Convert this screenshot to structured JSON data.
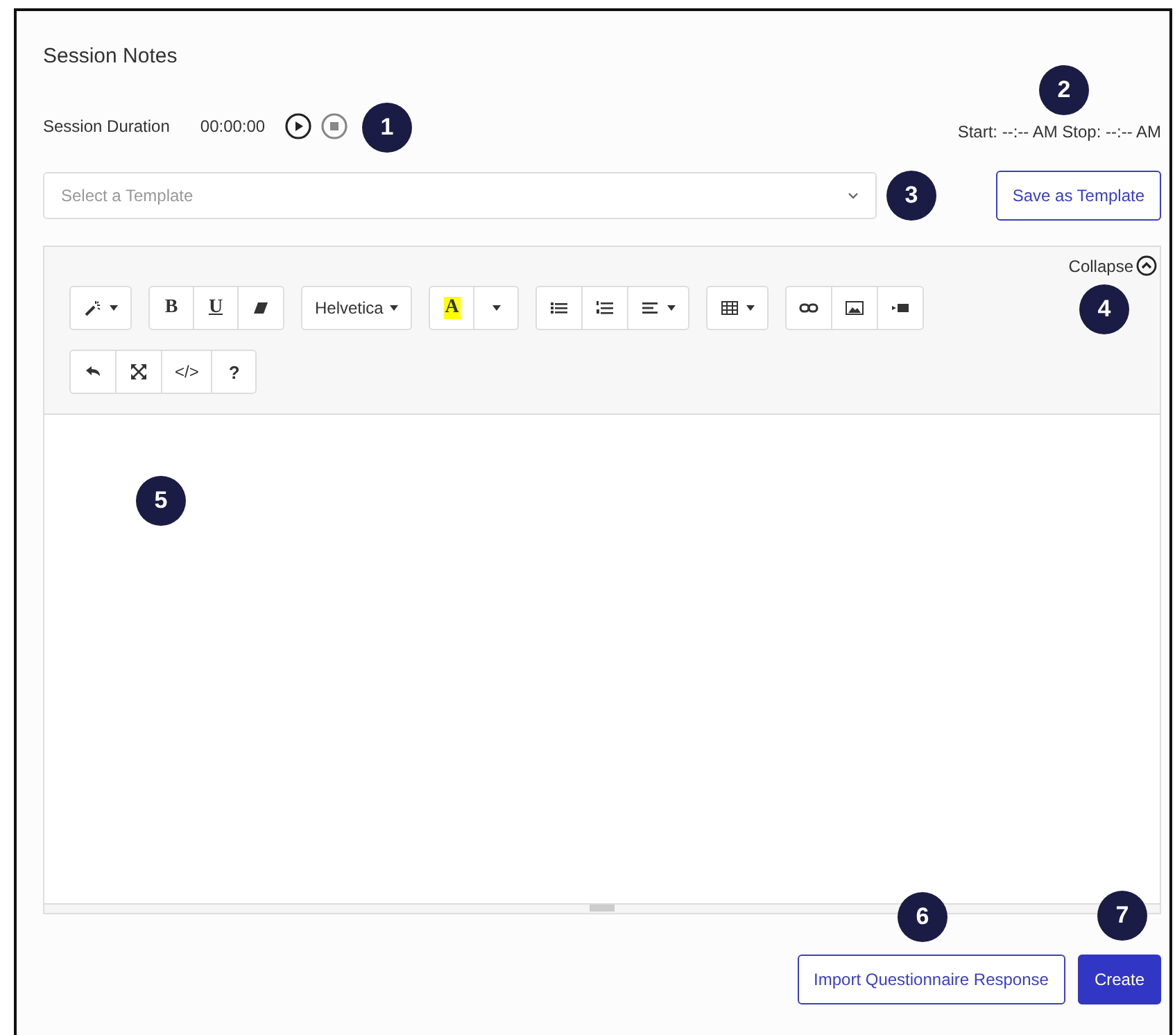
{
  "title": "Session Notes",
  "duration": {
    "label": "Session Duration",
    "time": "00:00:00",
    "start_stop": "Start: --:-- AM Stop: --:-- AM"
  },
  "template_select": {
    "placeholder": "Select a Template"
  },
  "save_template_button": "Save as Template",
  "editor": {
    "collapse": "Collapse",
    "toolbar_rows": [
      [
        [
          {
            "kind": "magic",
            "dropdown": true
          }
        ],
        [
          {
            "kind": "bold",
            "label": "B"
          },
          {
            "kind": "underline",
            "label": "U"
          },
          {
            "kind": "eraser"
          }
        ],
        [
          {
            "kind": "font",
            "label": "Helvetica",
            "dropdown": true
          }
        ],
        [
          {
            "kind": "highlight",
            "label": "A"
          },
          {
            "kind": "caret",
            "dropdown": true
          }
        ],
        [
          {
            "kind": "bullet-list"
          },
          {
            "kind": "number-list"
          },
          {
            "kind": "align",
            "dropdown": true
          }
        ],
        [
          {
            "kind": "table",
            "dropdown": true
          }
        ],
        [
          {
            "kind": "link"
          },
          {
            "kind": "image"
          },
          {
            "kind": "video"
          }
        ]
      ],
      [
        [
          {
            "kind": "undo"
          },
          {
            "kind": "fullscreen"
          },
          {
            "kind": "code",
            "label": "</>"
          },
          {
            "kind": "help",
            "label": "?"
          }
        ]
      ]
    ]
  },
  "buttons": [
    {
      "label": "Import Questionnaire Response",
      "kind": "outline"
    },
    {
      "label": "Create",
      "kind": "primary"
    }
  ],
  "callouts": [
    {
      "label": "1"
    },
    {
      "label": "2"
    },
    {
      "label": "3"
    },
    {
      "label": "4"
    },
    {
      "label": "5"
    },
    {
      "label": "6"
    },
    {
      "label": "7"
    }
  ]
}
